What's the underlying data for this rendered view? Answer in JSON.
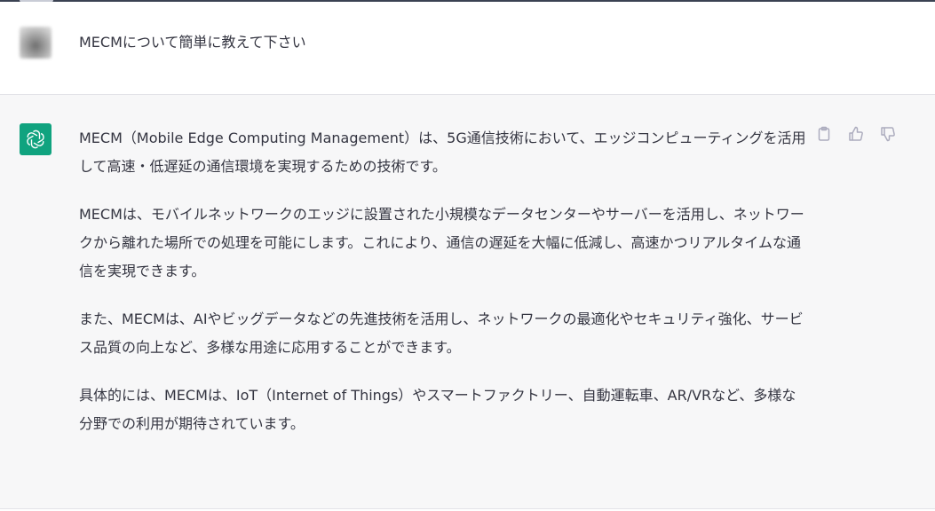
{
  "user_message": {
    "text": "MECMについて簡単に教えて下さい",
    "avatar_icon": "user-avatar"
  },
  "assistant_message": {
    "avatar_icon": "openai-logo-icon",
    "accent_color": "#10a37f",
    "paragraphs": [
      "MECM（Mobile Edge Computing Management）は、5G通信技術において、エッジコンピューティングを活用して高速・低遅延の通信環境を実現するための技術です。",
      "MECMは、モバイルネットワークのエッジに設置された小規模なデータセンターやサーバーを活用し、ネットワークから離れた場所での処理を可能にします。これにより、通信の遅延を大幅に低減し、高速かつリアルタイムな通信を実現できます。",
      "また、MECMは、AIやビッグデータなどの先進技術を活用し、ネットワークの最適化やセキュリティ強化、サービス品質の向上など、多様な用途に応用することができます。",
      "具体的には、MECMは、IoT（Internet of Things）やスマートファクトリー、自動運転車、AR/VRなど、多様な分野での利用が期待されています。"
    ],
    "action_icons": [
      "clipboard-icon",
      "thumbs-up-icon",
      "thumbs-down-icon"
    ]
  }
}
